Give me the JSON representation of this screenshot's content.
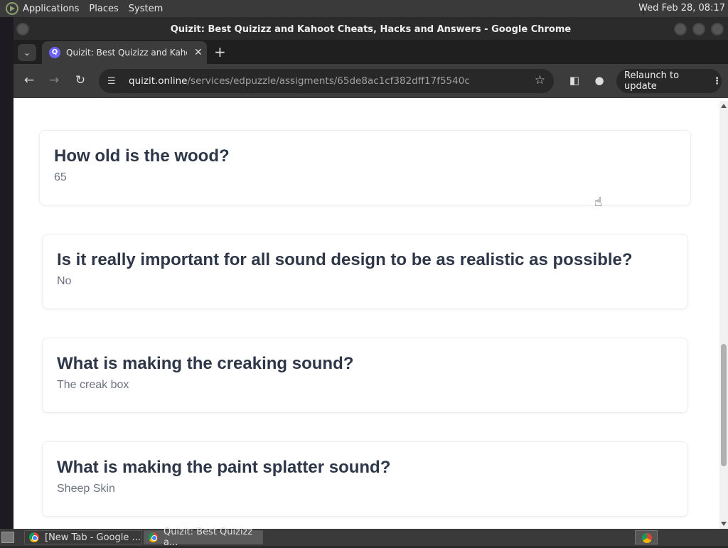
{
  "top_panel": {
    "menus": [
      "Applications",
      "Places",
      "System"
    ],
    "clock": "Wed Feb 28, 08:17"
  },
  "window": {
    "title": "Quizit: Best Quizizz and Kahoot Cheats, Hacks and Answers - Google Chrome"
  },
  "tabs": {
    "active_title": "Quizit: Best Quizizz and Kahoot Cheats, Hacks and Answers",
    "favicon_letter": "Q",
    "new_tab_symbol": "+"
  },
  "toolbar": {
    "url_host": "quizit.online",
    "url_path": "/services/edpuzzle/assigments/65de8ac1cf382dff17f5540c",
    "relaunch_label": "Relaunch to update"
  },
  "questions": [
    {
      "question": "How old is the wood?",
      "answer": "65"
    },
    {
      "question": "Is it really important for all sound design to be as realistic as possible?",
      "answer": "No"
    },
    {
      "question": "What is making the creaking sound?",
      "answer": "The creak box"
    },
    {
      "question": "What is making the paint splatter sound?",
      "answer": "Sheep Skin"
    }
  ],
  "taskbar": {
    "tasks": [
      "[New Tab - Google ...",
      "Quizit: Best Quizizz a..."
    ]
  },
  "colors": {
    "question_text": "#2d3748",
    "answer_text": "#6b7280",
    "chrome_dark": "#3c3c3c"
  }
}
